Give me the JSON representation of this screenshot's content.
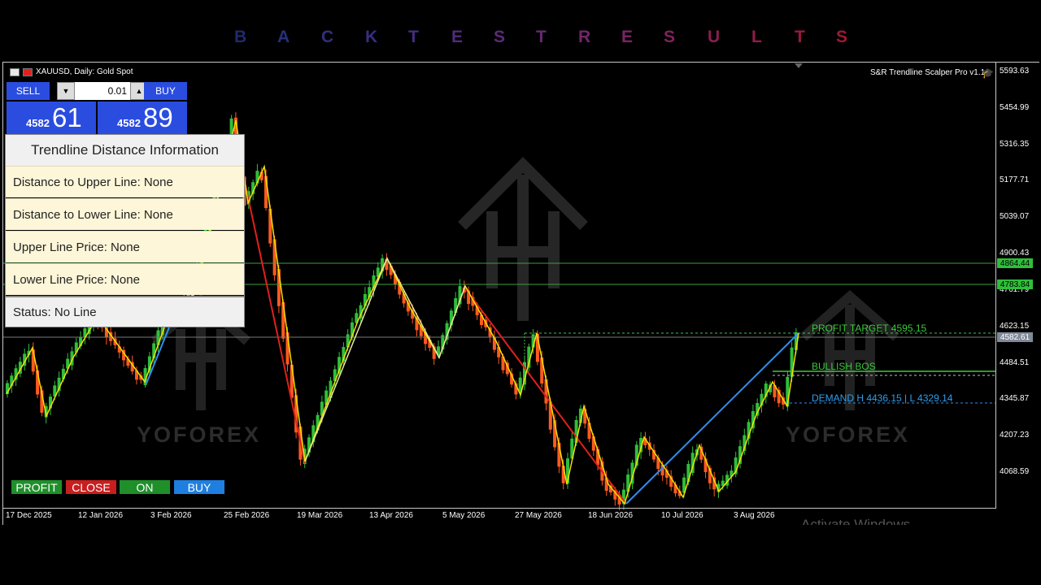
{
  "banner": {
    "letters": [
      "B",
      "A",
      "C",
      "K",
      "T",
      "E",
      "S",
      "T",
      "R",
      "E",
      "S",
      "U",
      "L",
      "T",
      "S"
    ],
    "colors": [
      "#1f2a6e",
      "#27307a",
      "#2f2f80",
      "#372e80",
      "#452d80",
      "#502b7c",
      "#5c2a78",
      "#672872",
      "#70266c",
      "#7a2464",
      "#82215c",
      "#8a1e52",
      "#921b48",
      "#991a3e",
      "#a01934"
    ]
  },
  "chart": {
    "symbol_title": "XAUUSD, Daily:  Gold Spot",
    "ea_name": "S&R Trendline Scalper Pro v1.1",
    "price_axis": [
      "5593.63",
      "5454.99",
      "5316.35",
      "5177.71",
      "5039.07",
      "4900.43",
      "4761.79",
      "4623.15",
      "4484.51",
      "4345.87",
      "4207.23",
      "4068.59"
    ],
    "price_tags": [
      {
        "text": "4864.44",
        "bg": "#2fbf3a",
        "fg": "#000"
      },
      {
        "text": "4783.84",
        "bg": "#2fbf3a",
        "fg": "#000"
      },
      {
        "text": "4582.61",
        "bg": "#7f8a99",
        "fg": "#fff"
      }
    ],
    "date_axis": [
      "17 Dec 2025",
      "12 Jan 2026",
      "3 Feb 2026",
      "25 Feb 2026",
      "19 Mar 2026",
      "13 Apr 2026",
      "5 May 2026",
      "27 May 2026",
      "18 Jun 2026",
      "10 Jul 2026",
      "3 Aug 2026"
    ],
    "annotations": {
      "profit_target": "PROFIT TARGET 4595.15",
      "bullish_bos": "BULLISH BOS",
      "demand": "DEMAND H 4436.15 | L 4329.14"
    },
    "watermark": "YOFOREX",
    "activate_windows": "Activate Windows",
    "colors": {
      "bull": "#2fbf3a",
      "bear": "#ff5a1f",
      "zigzag": "#f2e100",
      "red_trend": "#e0201e",
      "blue_trend": "#2c8ff0",
      "green_line": "#3c9f3c"
    }
  },
  "trade_panel": {
    "sell_label": "SELL",
    "buy_label": "BUY",
    "lot": "0.01",
    "sell_price_small": "4582",
    "sell_price_big": "61",
    "buy_price_small": "4582",
    "buy_price_big": "89"
  },
  "info_panel": {
    "title": "Trendline Distance Information",
    "rows": [
      "Distance to Upper Line: None",
      "Distance to Lower Line: None",
      "Upper Line Price: None",
      "Lower Line Price: None"
    ],
    "status": "Status: No Line"
  },
  "buttons": [
    {
      "label": "PROFIT",
      "color": "#1f8f2a"
    },
    {
      "label": "CLOSE",
      "color": "#c81e1e"
    },
    {
      "label": "ON",
      "color": "#1f8f2a"
    },
    {
      "label": "BUY",
      "color": "#1e7fe0"
    }
  ]
}
